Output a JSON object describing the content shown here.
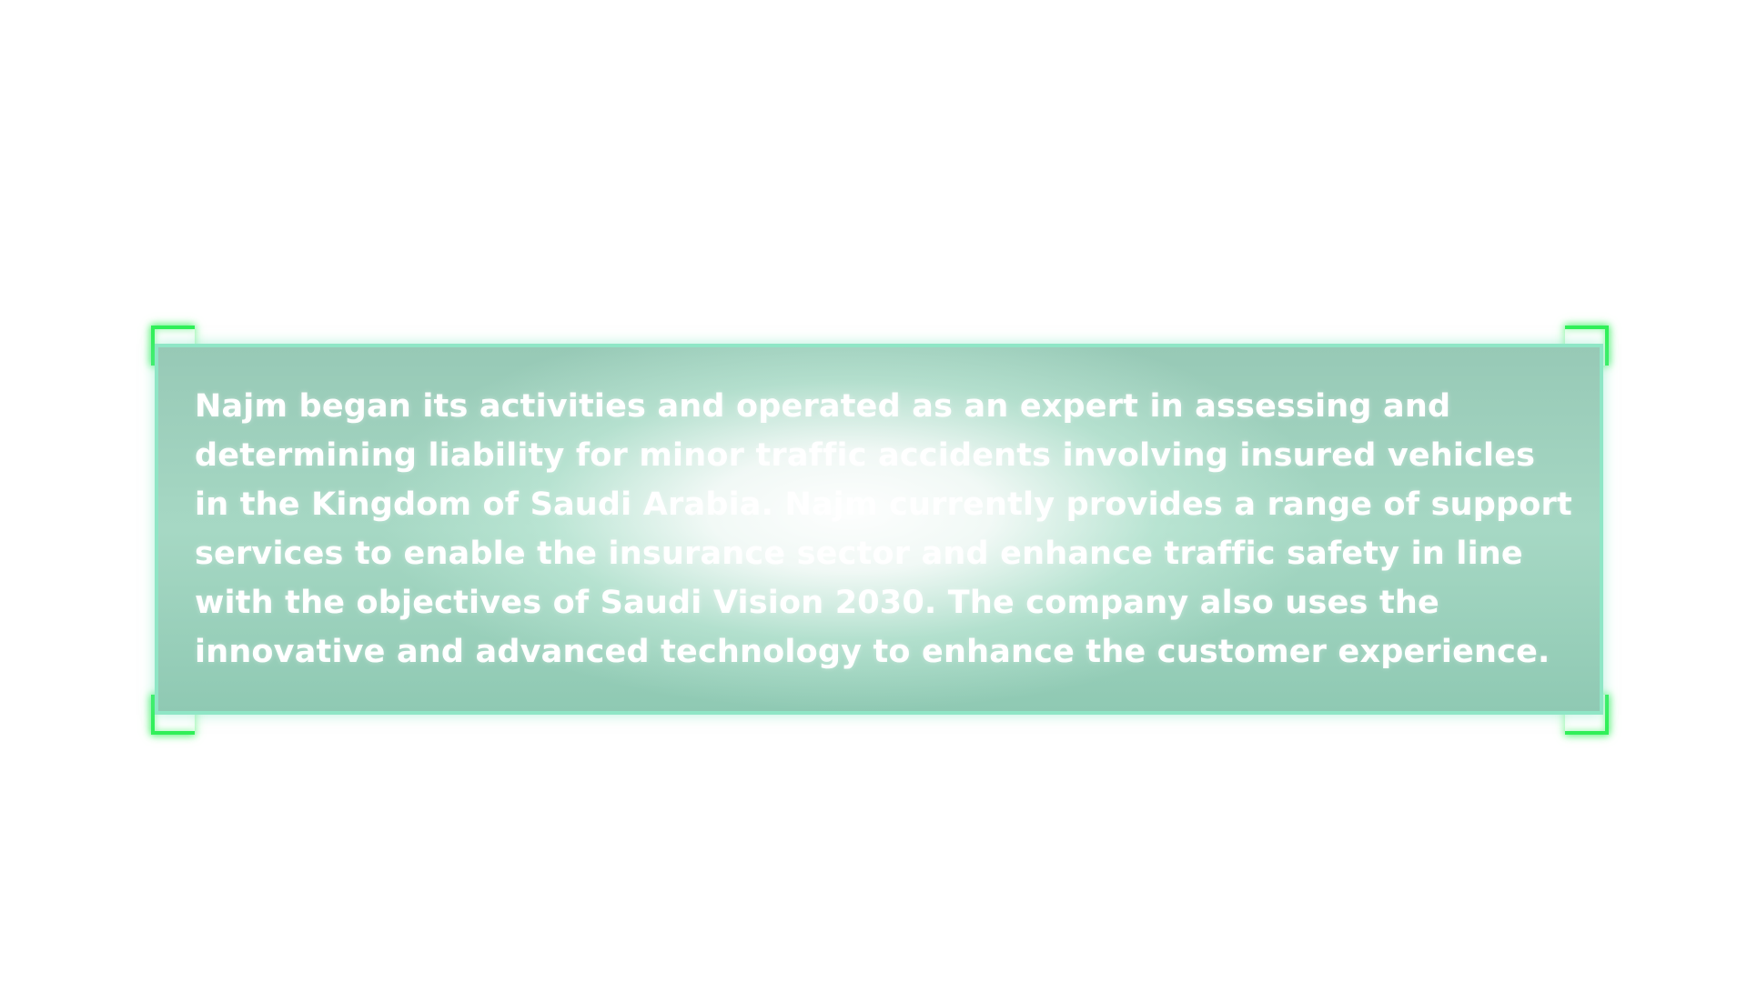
{
  "panel": {
    "text": "Najm began its activities and operated as an expert in assessing and determining liability for minor traffic accidents involving insured vehicles in the Kingdom of Saudi Arabia. Najm currently provides a range of support services to enable the insurance sector and enhance traffic safety in line with the objectives of Saudi Vision 2030. The company also uses the innovative and advanced technology to enhance the customer experience."
  },
  "colors": {
    "bracket": "#31f059",
    "panel_border": "#8fe6c6",
    "panel_fill": "#97c9b6",
    "text": "#ffffff"
  }
}
